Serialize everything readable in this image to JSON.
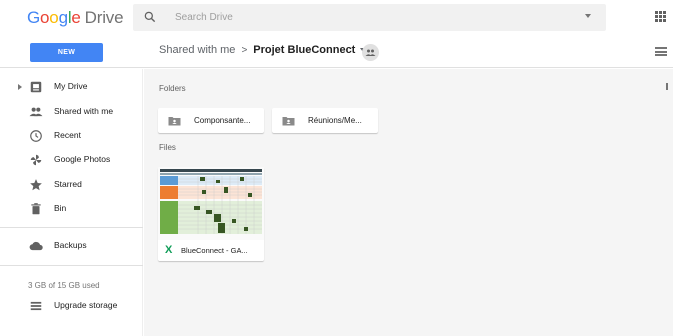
{
  "header": {
    "logo_parts": [
      "G",
      "o",
      "o",
      "g",
      "l",
      "e"
    ],
    "product": "Drive",
    "search_placeholder": "Search Drive"
  },
  "toolbar": {
    "new_label": "NEW",
    "breadcrumb_parent": "Shared with me",
    "breadcrumb_separator": ">",
    "breadcrumb_current": "Projet BlueConnect"
  },
  "sidebar": {
    "items": [
      {
        "label": "My Drive",
        "icon": "drive-icon"
      },
      {
        "label": "Shared with me",
        "icon": "people-icon"
      },
      {
        "label": "Recent",
        "icon": "clock-icon"
      },
      {
        "label": "Google Photos",
        "icon": "pinwheel-icon"
      },
      {
        "label": "Starred",
        "icon": "star-icon"
      },
      {
        "label": "Bin",
        "icon": "trash-icon"
      },
      {
        "label": "Backups",
        "icon": "cloud-icon"
      },
      {
        "label": "Upgrade storage",
        "icon": "storage-icon"
      }
    ],
    "storage_used": "3 GB of 15 GB used"
  },
  "main": {
    "folders_label": "Folders",
    "files_label": "Files",
    "folders": [
      {
        "name": "Componsante..."
      },
      {
        "name": "Réunions/Me..."
      }
    ],
    "files": [
      {
        "name": "BlueConnect - GA...",
        "type_glyph": "X"
      }
    ]
  },
  "colors": {
    "accent": "#4285f4",
    "sheets_green": "#0f9d58",
    "sidebar_active": "#e8f0fe",
    "main_bg": "#f5f5f5"
  }
}
